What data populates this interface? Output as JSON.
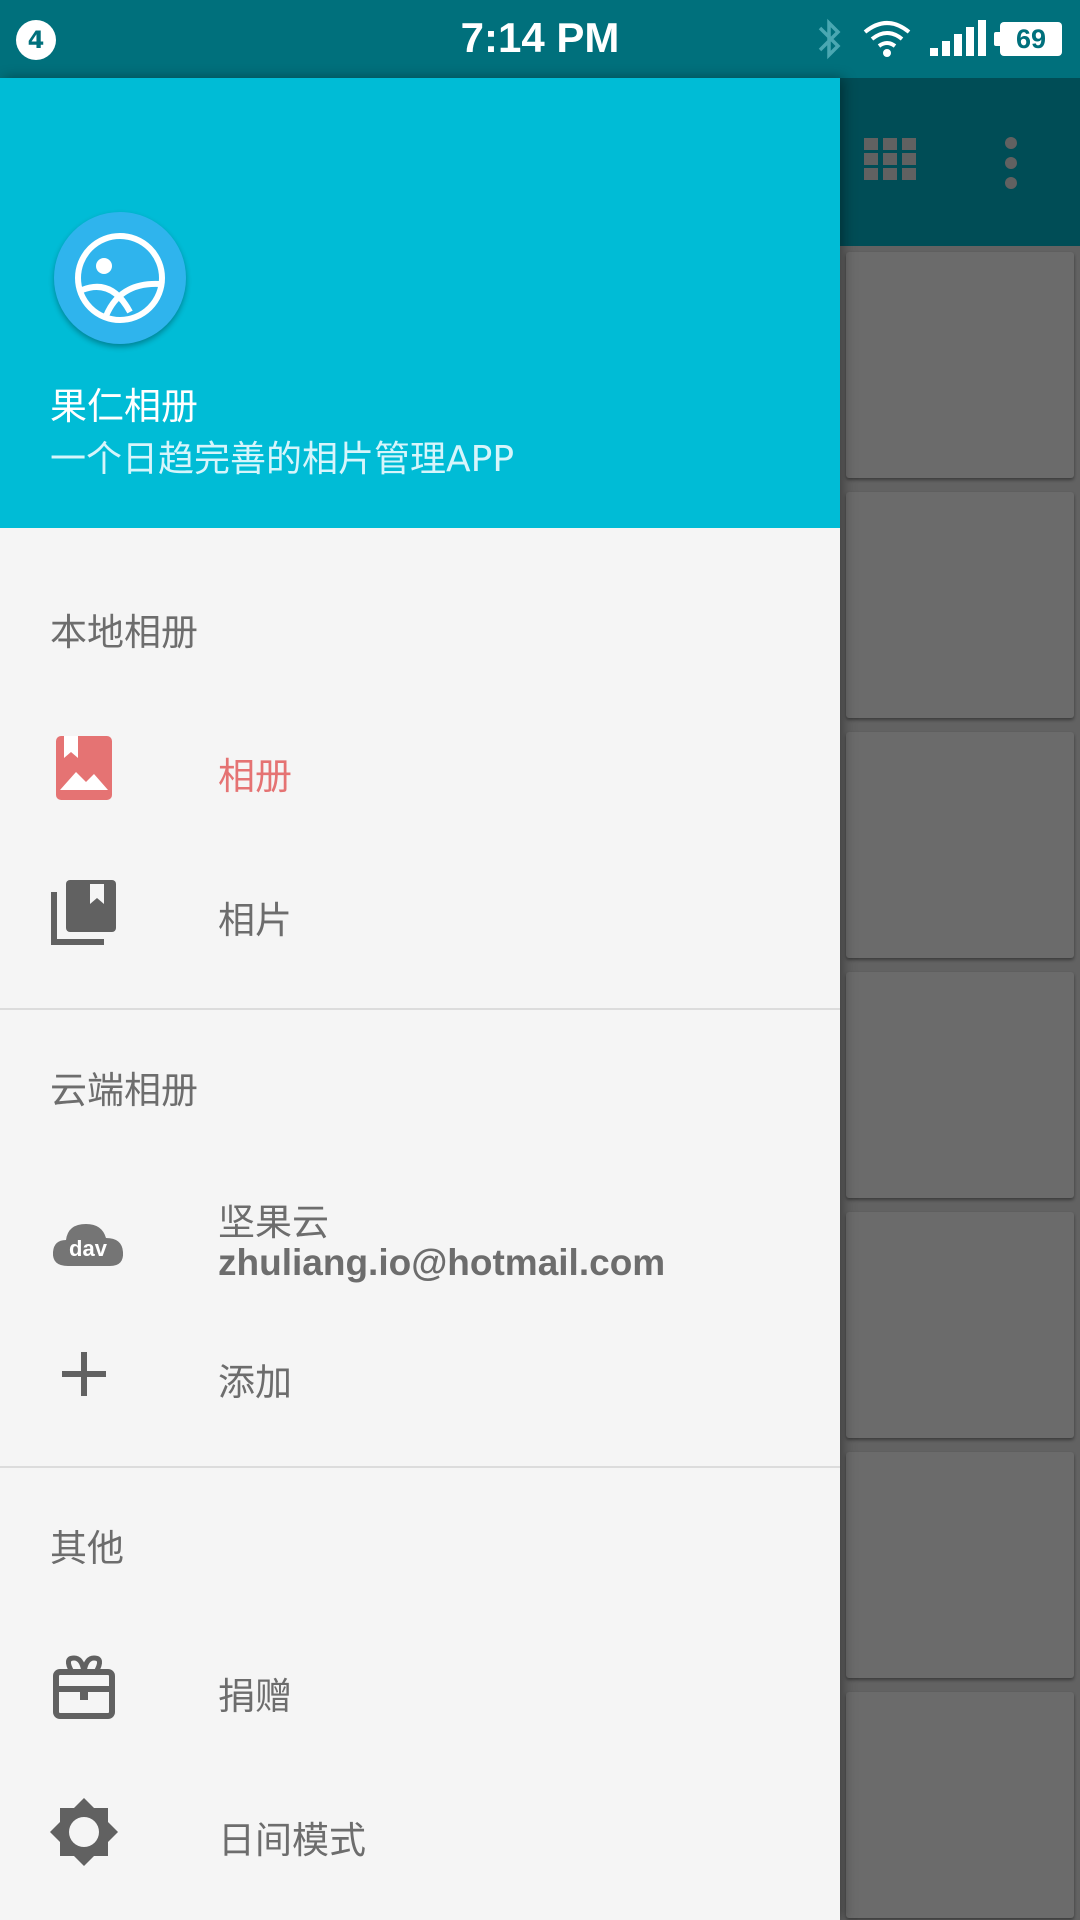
{
  "status_bar": {
    "notification_count": "4",
    "time": "7:14 PM",
    "battery": "69"
  },
  "drawer": {
    "header": {
      "app_name": "果仁相册",
      "app_description": "一个日趋完善的相片管理APP"
    },
    "sections": {
      "local": {
        "title": "本地相册",
        "items": [
          {
            "label": "相册",
            "icon": "album-icon",
            "active": true
          },
          {
            "label": "相片",
            "icon": "photo-library-icon",
            "active": false
          }
        ]
      },
      "cloud": {
        "title": "云端相册",
        "account": {
          "provider": "坚果云",
          "email": "zhuliang.io@hotmail.com",
          "icon": "dav-cloud-icon",
          "icon_text": "dav"
        },
        "add_label": "添加"
      },
      "other": {
        "title": "其他",
        "items": [
          {
            "label": "捐赠",
            "icon": "gift-icon"
          },
          {
            "label": "日间模式",
            "icon": "brightness-icon"
          }
        ]
      }
    }
  },
  "colors": {
    "status_bar": "#00707c",
    "header": "#00bcd6",
    "active_item": "#e57373",
    "drawer_bg": "#f5f5f5"
  }
}
